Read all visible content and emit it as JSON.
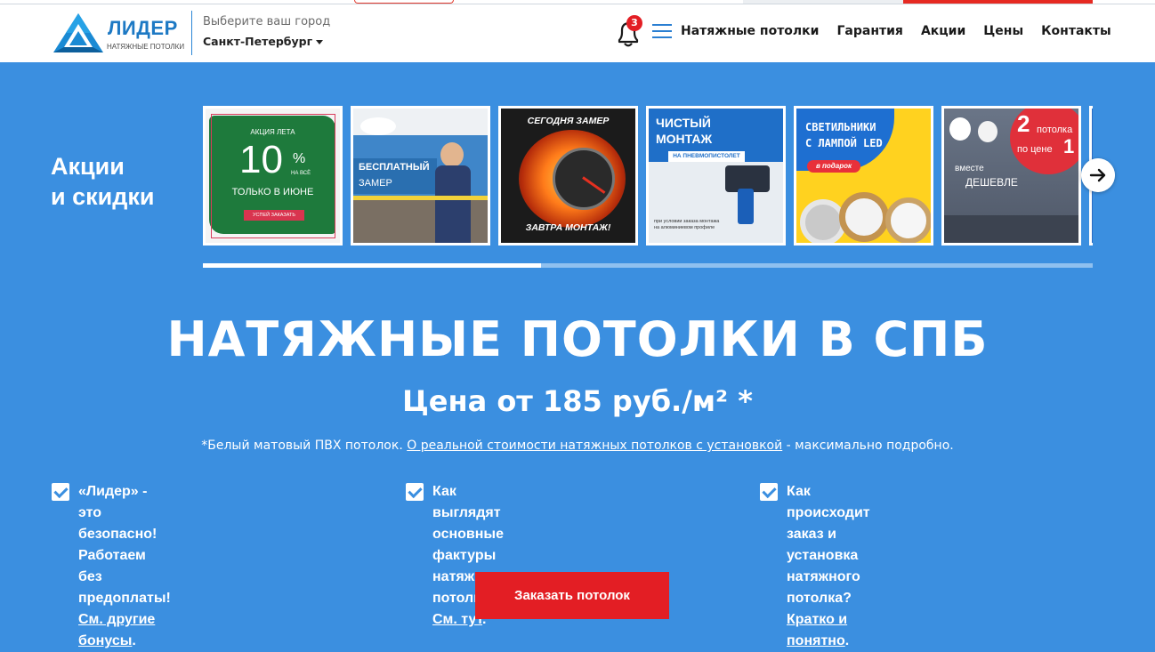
{
  "header": {
    "logo_name": "ЛИДЕР",
    "logo_sub": "НАТЯЖНЫЕ ПОТОЛКИ",
    "city_label": "Выберите ваш город",
    "city_value": "Санкт-Петербург",
    "notifications_count": "3",
    "nav": [
      "Натяжные потолки",
      "Гарантия",
      "Акции",
      "Цены",
      "Контакты"
    ]
  },
  "promo": {
    "title_line1": "Акции",
    "title_line2": "и скидки",
    "progress": 0.38,
    "slides": {
      "s1": {
        "top": "АКЦИЯ ЛЕТА",
        "big": "10",
        "pct": "%",
        "small": "НА ВСЁ",
        "middle": "ТОЛЬКО В ИЮНЕ",
        "button": "УСПЕЙ ЗАКАЗАТЬ"
      },
      "s2": {
        "line1": "БЕСПЛАТНЫЙ",
        "line2": "ЗАМЕР"
      },
      "s3": {
        "top": "СЕГОДНЯ ЗАМЕР",
        "bottom": "ЗАВТРА МОНТАЖ!"
      },
      "s4": {
        "line1": "ЧИСТЫЙ",
        "line2": "МОНТАЖ",
        "line3": "НА ПНЕВМОПИСТОЛЕТ",
        "note": "при условии заказа монтажа на алюминиевом профиле"
      },
      "s5": {
        "line1": "СВЕТИЛЬНИКИ",
        "line2": "С ЛАМПОЙ LED",
        "line3": "в подарок"
      },
      "s6": {
        "big": "2",
        "word1": "потолка",
        "word2": "по цене",
        "big2": "1",
        "line1": "вместе",
        "line2": "ДЕШЕВЛЕ"
      }
    }
  },
  "hero": {
    "title": "НАТЯЖНЫЕ ПОТОЛКИ В СПБ",
    "price": "Цена от 185 руб./м² *",
    "note_prefix": "*Белый матовый ПВХ потолок.",
    "note_link": "О реальной стоимости натяжных потолков с установкой",
    "note_suffix": "- максимально подробно."
  },
  "features": [
    {
      "line1": "«Лидер» - это безопасно! Работаем без",
      "line2_prefix": "предоплаты!",
      "link": "См. другие бонусы",
      "tail": "."
    },
    {
      "line1": "Как выглядят основные фактуры",
      "line2_prefix": "натяжных потолков?",
      "link": "См. тут",
      "tail": "."
    },
    {
      "line1": "Как происходит заказ и установка",
      "line2_prefix": "натяжного потолка?",
      "link": "Кратко и понятно",
      "tail": "."
    }
  ],
  "cta_label": "Заказать потолок"
}
